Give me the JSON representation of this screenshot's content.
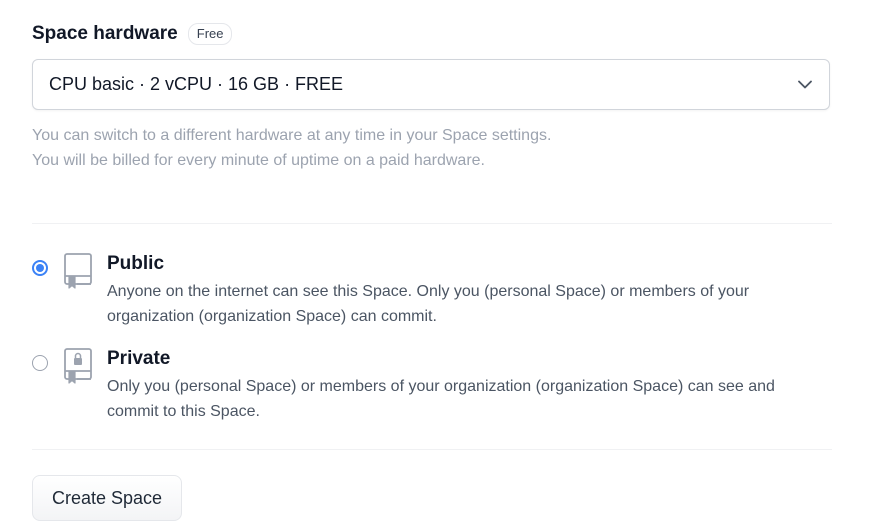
{
  "hardware": {
    "title": "Space hardware",
    "badge": "Free",
    "selected": "CPU basic · 2 vCPU · 16 GB · FREE",
    "help_line1": "You can switch to a different hardware at any time in your Space settings.",
    "help_line2": "You will be billed for every minute of uptime on a paid hardware."
  },
  "visibility": {
    "public": {
      "title": "Public",
      "desc_line1": "Anyone on the internet can see this Space. Only you (personal Space) or members of your",
      "desc_line2": "organization (organization Space) can commit.",
      "checked": true,
      "icon": "repo-icon"
    },
    "private": {
      "title": "Private",
      "desc_line1": "Only you (personal Space) or members of your organization (organization Space) can see and",
      "desc_line2": "commit to this Space.",
      "checked": false,
      "icon": "repo-lock-icon"
    }
  },
  "actions": {
    "create_label": "Create Space"
  },
  "colors": {
    "accent": "#3b82f6",
    "muted_text": "#9ca3af",
    "body_text": "#4b5563"
  }
}
